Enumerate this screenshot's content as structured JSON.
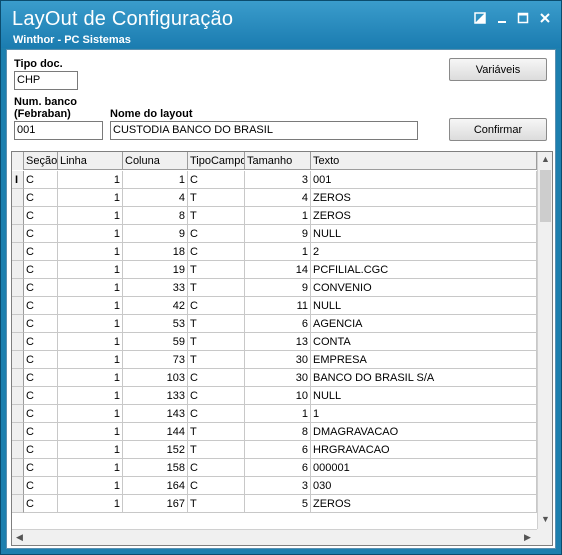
{
  "window": {
    "title": "LayOut de Configuração",
    "subtitle": "Winthor - PC Sistemas",
    "controls": [
      "restore",
      "minimize",
      "maximize",
      "close"
    ]
  },
  "form": {
    "tipo_doc_label": "Tipo doc.",
    "tipo_doc_value": "CHP",
    "num_banco_label": "Num. banco",
    "febraban_label": "(Febraban)",
    "num_banco_value": "001",
    "nome_layout_label": "Nome do layout",
    "nome_layout_value": "CUSTODIA BANCO DO BRASIL"
  },
  "buttons": {
    "variaveis": "Variáveis",
    "confirmar": "Confirmar"
  },
  "grid": {
    "columns": [
      "Seção",
      "Linha",
      "Coluna",
      "TipoCampo",
      "Tamanho",
      "Texto"
    ],
    "rows": [
      [
        "C",
        "1",
        "1",
        "C",
        "3",
        "001"
      ],
      [
        "C",
        "1",
        "4",
        "T",
        "4",
        "ZEROS"
      ],
      [
        "C",
        "1",
        "8",
        "T",
        "1",
        "ZEROS"
      ],
      [
        "C",
        "1",
        "9",
        "C",
        "9",
        "NULL"
      ],
      [
        "C",
        "1",
        "18",
        "C",
        "1",
        "2"
      ],
      [
        "C",
        "1",
        "19",
        "T",
        "14",
        "PCFILIAL.CGC"
      ],
      [
        "C",
        "1",
        "33",
        "T",
        "9",
        "CONVENIO"
      ],
      [
        "C",
        "1",
        "42",
        "C",
        "11",
        "NULL"
      ],
      [
        "C",
        "1",
        "53",
        "T",
        "6",
        "AGENCIA"
      ],
      [
        "C",
        "1",
        "59",
        "T",
        "13",
        "CONTA"
      ],
      [
        "C",
        "1",
        "73",
        "T",
        "30",
        "EMPRESA"
      ],
      [
        "C",
        "1",
        "103",
        "C",
        "30",
        "BANCO DO BRASIL S/A"
      ],
      [
        "C",
        "1",
        "133",
        "C",
        "10",
        "NULL"
      ],
      [
        "C",
        "1",
        "143",
        "C",
        "1",
        "1"
      ],
      [
        "C",
        "1",
        "144",
        "T",
        "8",
        "DMAGRAVACAO"
      ],
      [
        "C",
        "1",
        "152",
        "T",
        "6",
        "HRGRAVACAO"
      ],
      [
        "C",
        "1",
        "158",
        "C",
        "6",
        "000001"
      ],
      [
        "C",
        "1",
        "164",
        "C",
        "3",
        "030"
      ],
      [
        "C",
        "1",
        "167",
        "T",
        "5",
        "ZEROS"
      ]
    ]
  }
}
